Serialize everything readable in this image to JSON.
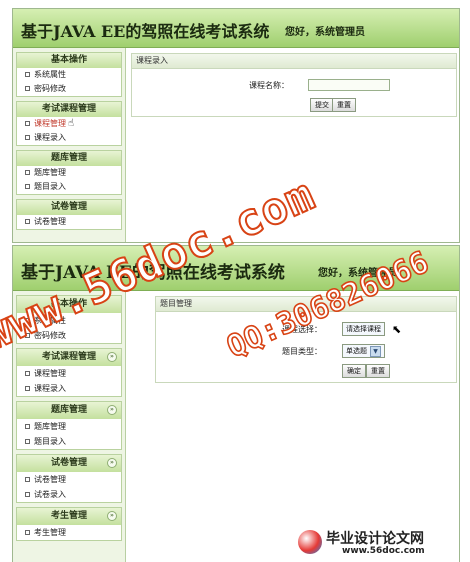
{
  "app": {
    "title": "基于JAVA EE的驾照在线考试系统",
    "greeting": "您好，系统管理员"
  },
  "top": {
    "sidebar": [
      {
        "title": "基本操作",
        "items": [
          "系统属性",
          "密码修改"
        ]
      },
      {
        "title": "考试课程管理",
        "items": [
          "课程管理",
          "课程录入"
        ]
      },
      {
        "title": "题库管理",
        "items": [
          "题库管理",
          "题目录入"
        ]
      },
      {
        "title": "试卷管理",
        "items": [
          "试卷管理"
        ]
      }
    ],
    "panel": {
      "title": "课程录入",
      "field_label": "课程名称：",
      "field_value": "",
      "submit_label": "提交",
      "reset_label": "重置"
    }
  },
  "bottom": {
    "sidebar": [
      {
        "title": "基本操作",
        "items": [
          "系统属性",
          "密码修改"
        ]
      },
      {
        "title": "考试课程管理",
        "items": [
          "课程管理",
          "课程录入"
        ]
      },
      {
        "title": "题库管理",
        "items": [
          "题库管理",
          "题目录入"
        ]
      },
      {
        "title": "试卷管理",
        "items": [
          "试卷管理",
          "试卷录入"
        ]
      },
      {
        "title": "考生管理",
        "items": [
          "考生管理"
        ]
      }
    ],
    "panel": {
      "title": "题目管理",
      "course_label": "课程选择：",
      "course_value": "请选择课程",
      "type_label": "题目类型：",
      "type_value": "单选题",
      "confirm_label": "确定",
      "reset_label": "重置"
    }
  },
  "watermark": {
    "url": "www.56doc.com",
    "qq": "QQ:306826066"
  },
  "footer": {
    "brand": "毕业设计论文网",
    "site": "www.56doc.com"
  },
  "colors": {
    "header_green": "#9fcf6e",
    "watermark_red": "#d84315"
  }
}
